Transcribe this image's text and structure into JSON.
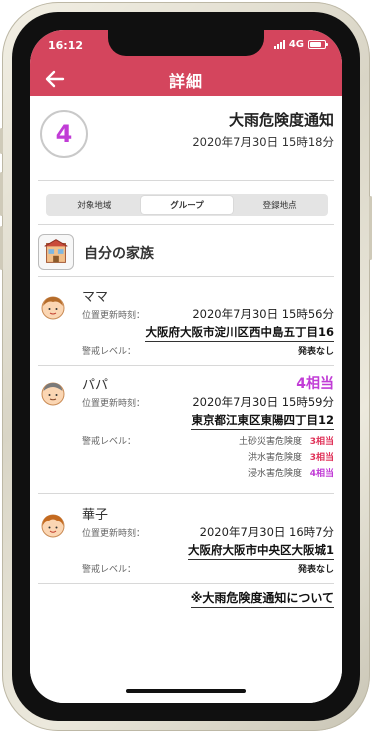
{
  "status_bar": {
    "time": "16:12",
    "network": "4G"
  },
  "header": {
    "title": "詳細"
  },
  "alert": {
    "level": "4",
    "title": "大雨危険度通知",
    "datetime": "2020年7月30日 15時18分"
  },
  "tabs": [
    {
      "label": "対象地域",
      "active": false
    },
    {
      "label": "グループ",
      "active": true
    },
    {
      "label": "登録地点",
      "active": false
    }
  ],
  "group": {
    "name": "自分の家族",
    "icon": "house-icon"
  },
  "labels": {
    "updated": "位置更新時刻：",
    "warning": "警戒レベル："
  },
  "members": [
    {
      "name": "ママ",
      "updated": "2020年7月30日 15時56分",
      "address": "大阪府大阪市淀川区西中島五丁目16",
      "status": "発表なし"
    },
    {
      "name": "パパ",
      "level": "4相当",
      "updated": "2020年7月30日 15時59分",
      "address": "東京都江東区東陽四丁目12",
      "risks": [
        {
          "label": "土砂災害危険度",
          "value": "3相当",
          "color": "#e0345a"
        },
        {
          "label": "洪水害危険度",
          "value": "3相当",
          "color": "#e0345a"
        },
        {
          "label": "浸水害危険度",
          "value": "4相当",
          "color": "#c13cd6"
        }
      ]
    },
    {
      "name": "華子",
      "updated": "2020年7月30日 16時7分",
      "address": "大阪府大阪市中央区大阪城1",
      "status": "発表なし"
    }
  ],
  "footer": {
    "link": "※大雨危険度通知について"
  },
  "colors": {
    "header": "#d4455d",
    "level4": "#c13cd6",
    "level3": "#e0345a"
  }
}
